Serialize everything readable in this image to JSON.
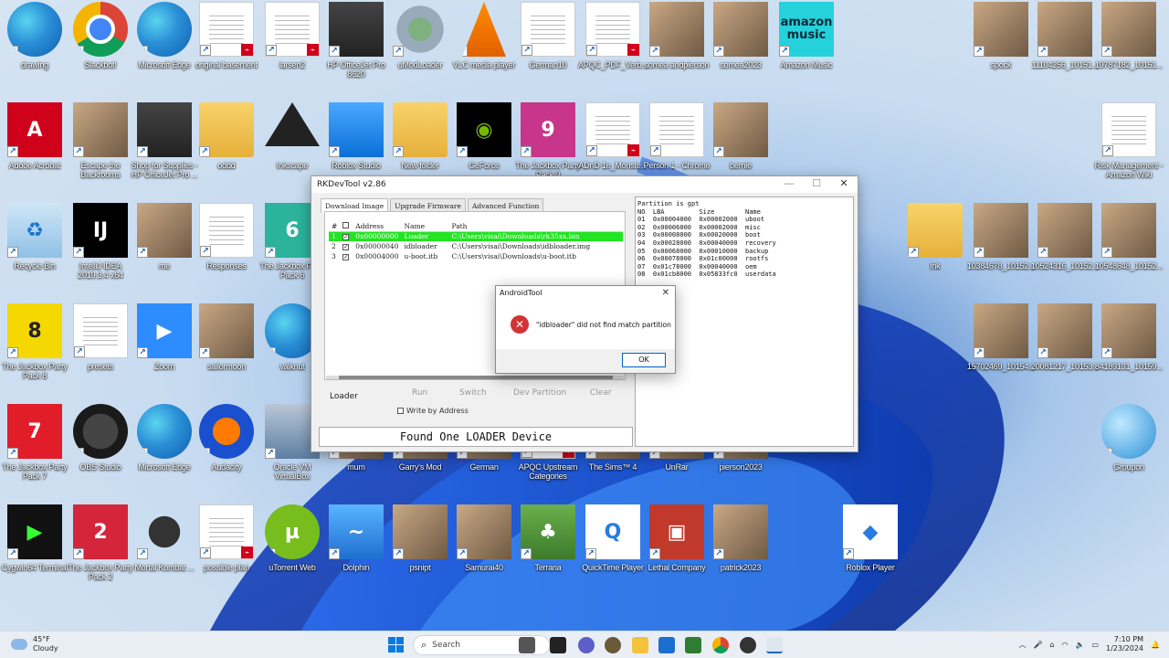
{
  "desktop_icons": [
    {
      "label": "drawing",
      "kind": "edge"
    },
    {
      "label": "Slackbot!",
      "kind": "chrome"
    },
    {
      "label": "Microsoft Edge",
      "kind": "edge"
    },
    {
      "label": "original basement",
      "kind": "doc-pdf"
    },
    {
      "label": "larsen2",
      "kind": "doc-pdf"
    },
    {
      "label": "HP OfficeJet Pro 8620",
      "kind": "printer"
    },
    {
      "label": "uModLoader",
      "kind": "gear"
    },
    {
      "label": "VLC media player",
      "kind": "vlc"
    },
    {
      "label": "German10",
      "kind": "doc"
    },
    {
      "label": "APQC_PDF_Verb...",
      "kind": "doc-pdf"
    },
    {
      "label": "somea andpierson",
      "kind": "photo"
    },
    {
      "label": "somea2023",
      "kind": "photo"
    },
    {
      "label": "Amazon Music",
      "kind": "amazon",
      "text": "amazon music"
    },
    {
      "label": "spock",
      "kind": "photo"
    },
    {
      "label": "11104256_10151...",
      "kind": "photo"
    },
    {
      "label": "19787182_10151...",
      "kind": "photo"
    },
    {
      "label": "Adobe Acrobat",
      "kind": "acrobat"
    },
    {
      "label": "Escape the Backrooms",
      "kind": "photo"
    },
    {
      "label": "Shop for Supplies - HP OfficeJet Pro ...",
      "kind": "printer"
    },
    {
      "label": "oddd",
      "kind": "folder"
    },
    {
      "label": "Inkscape",
      "kind": "inkscape"
    },
    {
      "label": "Roblox Studio",
      "kind": "roblox"
    },
    {
      "label": "New folder",
      "kind": "folder"
    },
    {
      "label": "GeForce",
      "kind": "nvidia"
    },
    {
      "label": "The Jackbox Party Pack 9",
      "kind": "jackbox9"
    },
    {
      "label": "ADnD 1e_Monste...",
      "kind": "doc-pdf"
    },
    {
      "label": "Person 1 - Chrome",
      "kind": "doc"
    },
    {
      "label": "bernie",
      "kind": "photo"
    },
    {
      "label": "Risk Management - Amazon Wiki",
      "kind": "doc"
    },
    {
      "label": "Recycle Bin",
      "kind": "recycle"
    },
    {
      "label": "IntelliJ IDEA 2019.3.4 x64",
      "kind": "intellij"
    },
    {
      "label": "me",
      "kind": "photo"
    },
    {
      "label": "Responses",
      "kind": "doc"
    },
    {
      "label": "The Jackbox Party Pack 6",
      "kind": "jackbox6"
    },
    {
      "label": "ink",
      "kind": "folder"
    },
    {
      "label": "10384678_10152...",
      "kind": "photo"
    },
    {
      "label": "10524316_10152...",
      "kind": "photo"
    },
    {
      "label": "10548648_10152...",
      "kind": "photo"
    },
    {
      "label": "The Jackbox Party Pack 8",
      "kind": "jackbox8"
    },
    {
      "label": "Zoom",
      "kind": "zoom"
    },
    {
      "label": "presets",
      "kind": "doc"
    },
    {
      "label": "sailormoon",
      "kind": "photo"
    },
    {
      "label": "valknut",
      "kind": "edge"
    },
    {
      "label": "15702469_10154...",
      "kind": "photo"
    },
    {
      "label": "20081217_10153...",
      "kind": "photo"
    },
    {
      "label": "84189131_10159...",
      "kind": "photo"
    },
    {
      "label": "The Jackbox Party Pack 7",
      "kind": "jackbox7"
    },
    {
      "label": "OBS Studio",
      "kind": "obs"
    },
    {
      "label": "Microsoft Edge",
      "kind": "edge"
    },
    {
      "label": "Audacity",
      "kind": "audacity"
    },
    {
      "label": "Oracle VM VirtualBox",
      "kind": "vbox"
    },
    {
      "label": "mum",
      "kind": "photo"
    },
    {
      "label": "Garry's Mod",
      "kind": "photo"
    },
    {
      "label": "German",
      "kind": "photo"
    },
    {
      "label": "APQC Upstream Categories",
      "kind": "doc-pdf"
    },
    {
      "label": "The Sims™ 4",
      "kind": "photo"
    },
    {
      "label": "UnRar",
      "kind": "photo"
    },
    {
      "label": "pierson2023",
      "kind": "photo"
    },
    {
      "label": "Groupon",
      "kind": "globe"
    },
    {
      "label": "Cygwin64 Terminal",
      "kind": "cygwin"
    },
    {
      "label": "The Jackbox Party Pack 2",
      "kind": "jackbox2"
    },
    {
      "label": "Mortal Kombat ...",
      "kind": "mk"
    },
    {
      "label": "possible plan",
      "kind": "doc-pdf"
    },
    {
      "label": "uTorrent Web",
      "kind": "utorrent"
    },
    {
      "label": "Dolphin",
      "kind": "dolphin"
    },
    {
      "label": "psnipt",
      "kind": "photo"
    },
    {
      "label": "Samurai40",
      "kind": "photo"
    },
    {
      "label": "Terraria",
      "kind": "terraria"
    },
    {
      "label": "QuickTime Player",
      "kind": "quicktime"
    },
    {
      "label": "Lethal Company",
      "kind": "lethal"
    },
    {
      "label": "patrick2023",
      "kind": "photo"
    },
    {
      "label": "Roblox Player",
      "kind": "robloxplayer"
    }
  ],
  "rk_window": {
    "title": "RKDevTool v2.86",
    "tabs": [
      "Download Image",
      "Upgrade Firmware",
      "Advanced Function"
    ],
    "table_headers": [
      "#",
      "",
      "Address",
      "Name",
      "Path"
    ],
    "rows": [
      {
        "num": "1",
        "checked": true,
        "address": "0x00000000",
        "name": "Loader",
        "path": "C:\\Users\\visai\\Downloads\\rk35xx.bin",
        "selected": true
      },
      {
        "num": "2",
        "checked": true,
        "address": "0x00000040",
        "name": "idbloader",
        "path": "C:\\Users\\visai\\Downloads\\idbloader.img",
        "selected": false
      },
      {
        "num": "3",
        "checked": true,
        "address": "0x00004000",
        "name": "u-boot.itb",
        "path": "C:\\Users\\visai\\Downloads\\u-boot.itb",
        "selected": false
      }
    ],
    "buttons": [
      "Run",
      "Switch",
      "Dev Partition",
      "Clear"
    ],
    "loader_label": "Loader",
    "write_by_address": "Write by Address",
    "status": "Found One LOADER Device",
    "log_lines": [
      "Partition is gpt",
      "NO  LBA         Size        Name",
      "01  0x00004000  0x00002000  uboot",
      "02  0x00006000  0x00002000  misc",
      "03  0x00008000  0x00020000  boot",
      "04  0x00028000  0x00040000  recovery",
      "05  0x00068000  0x00010000  backup",
      "06  0x00078000  0x01c00000  rootfs",
      "07  0x01c78000  0x00040000  oem",
      "08  0x01cb8000  0x05833fc0  userdata"
    ]
  },
  "dialog": {
    "title": "AndroidTool",
    "message": "\"idbloader\" did not find match partition",
    "ok_label": "OK"
  },
  "taskbar": {
    "weather_temp": "45°F",
    "weather_desc": "Cloudy",
    "search_placeholder": "Search",
    "time": "7:10 PM",
    "date": "1/23/2024"
  },
  "colors": {
    "selected_row": "#21e521",
    "error_icon": "#d13438",
    "accent": "#0067c0"
  }
}
